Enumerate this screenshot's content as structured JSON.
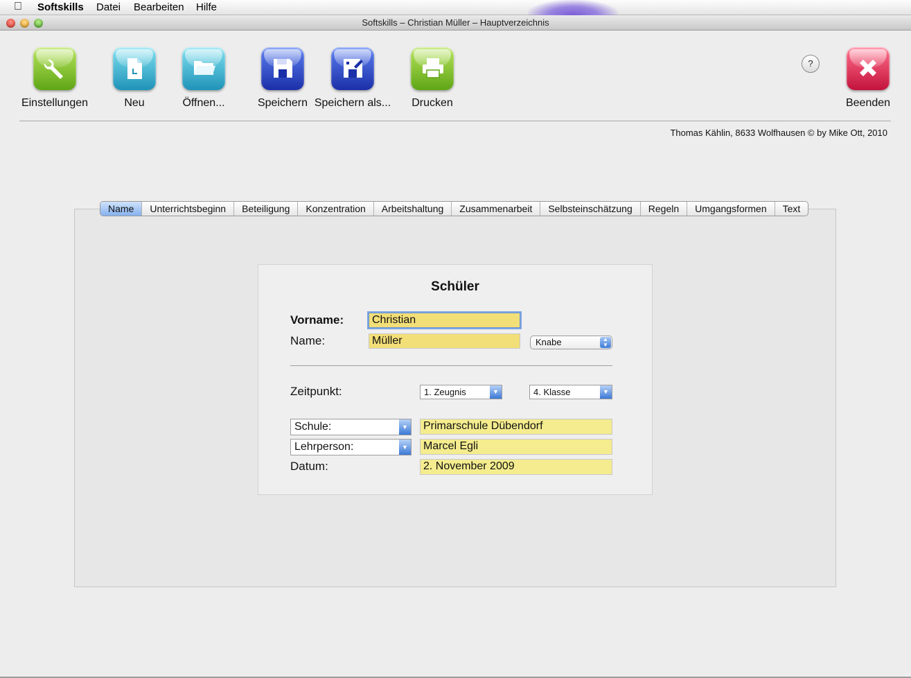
{
  "menubar": {
    "app_name": "Softskills",
    "items": [
      "Datei",
      "Bearbeiten",
      "Hilfe"
    ]
  },
  "window": {
    "title": "Softskills – Christian Müller – Hauptverzeichnis"
  },
  "toolbar": {
    "settings_label": "Einstellungen",
    "new_label": "Neu",
    "open_label": "Öffnen...",
    "save_label": "Speichern",
    "save_as_label": "Speichern als...",
    "print_label": "Drucken",
    "quit_label": "Beenden",
    "help_label": "?"
  },
  "copyright": "Thomas Kählin, 8633 Wolfhausen © by Mike Ott, 2010",
  "tabs": [
    "Name",
    "Unterrichtsbeginn",
    "Beteiligung",
    "Konzentration",
    "Arbeitshaltung",
    "Zusammenarbeit",
    "Selbsteinschätzung",
    "Regeln",
    "Umgangsformen",
    "Text"
  ],
  "form": {
    "title": "Schüler",
    "vorname_label": "Vorname:",
    "vorname_value": "Christian",
    "name_label": "Name:",
    "name_value": "Müller",
    "gender_value": "Knabe",
    "zeitpunkt_label": "Zeitpunkt:",
    "zeugnis_value": "1. Zeugnis",
    "klasse_value": "4. Klasse",
    "schule_label": "Schule:",
    "schule_value": "Primarschule Dübendorf",
    "lehrperson_label": "Lehrperson:",
    "lehrperson_value": "Marcel Egli",
    "datum_label": "Datum:",
    "datum_value": "2. November 2009"
  },
  "colors": {
    "accent": "#4a7bd6",
    "field_orange": "#f3df78",
    "field_yellow": "#f4ec8e"
  }
}
